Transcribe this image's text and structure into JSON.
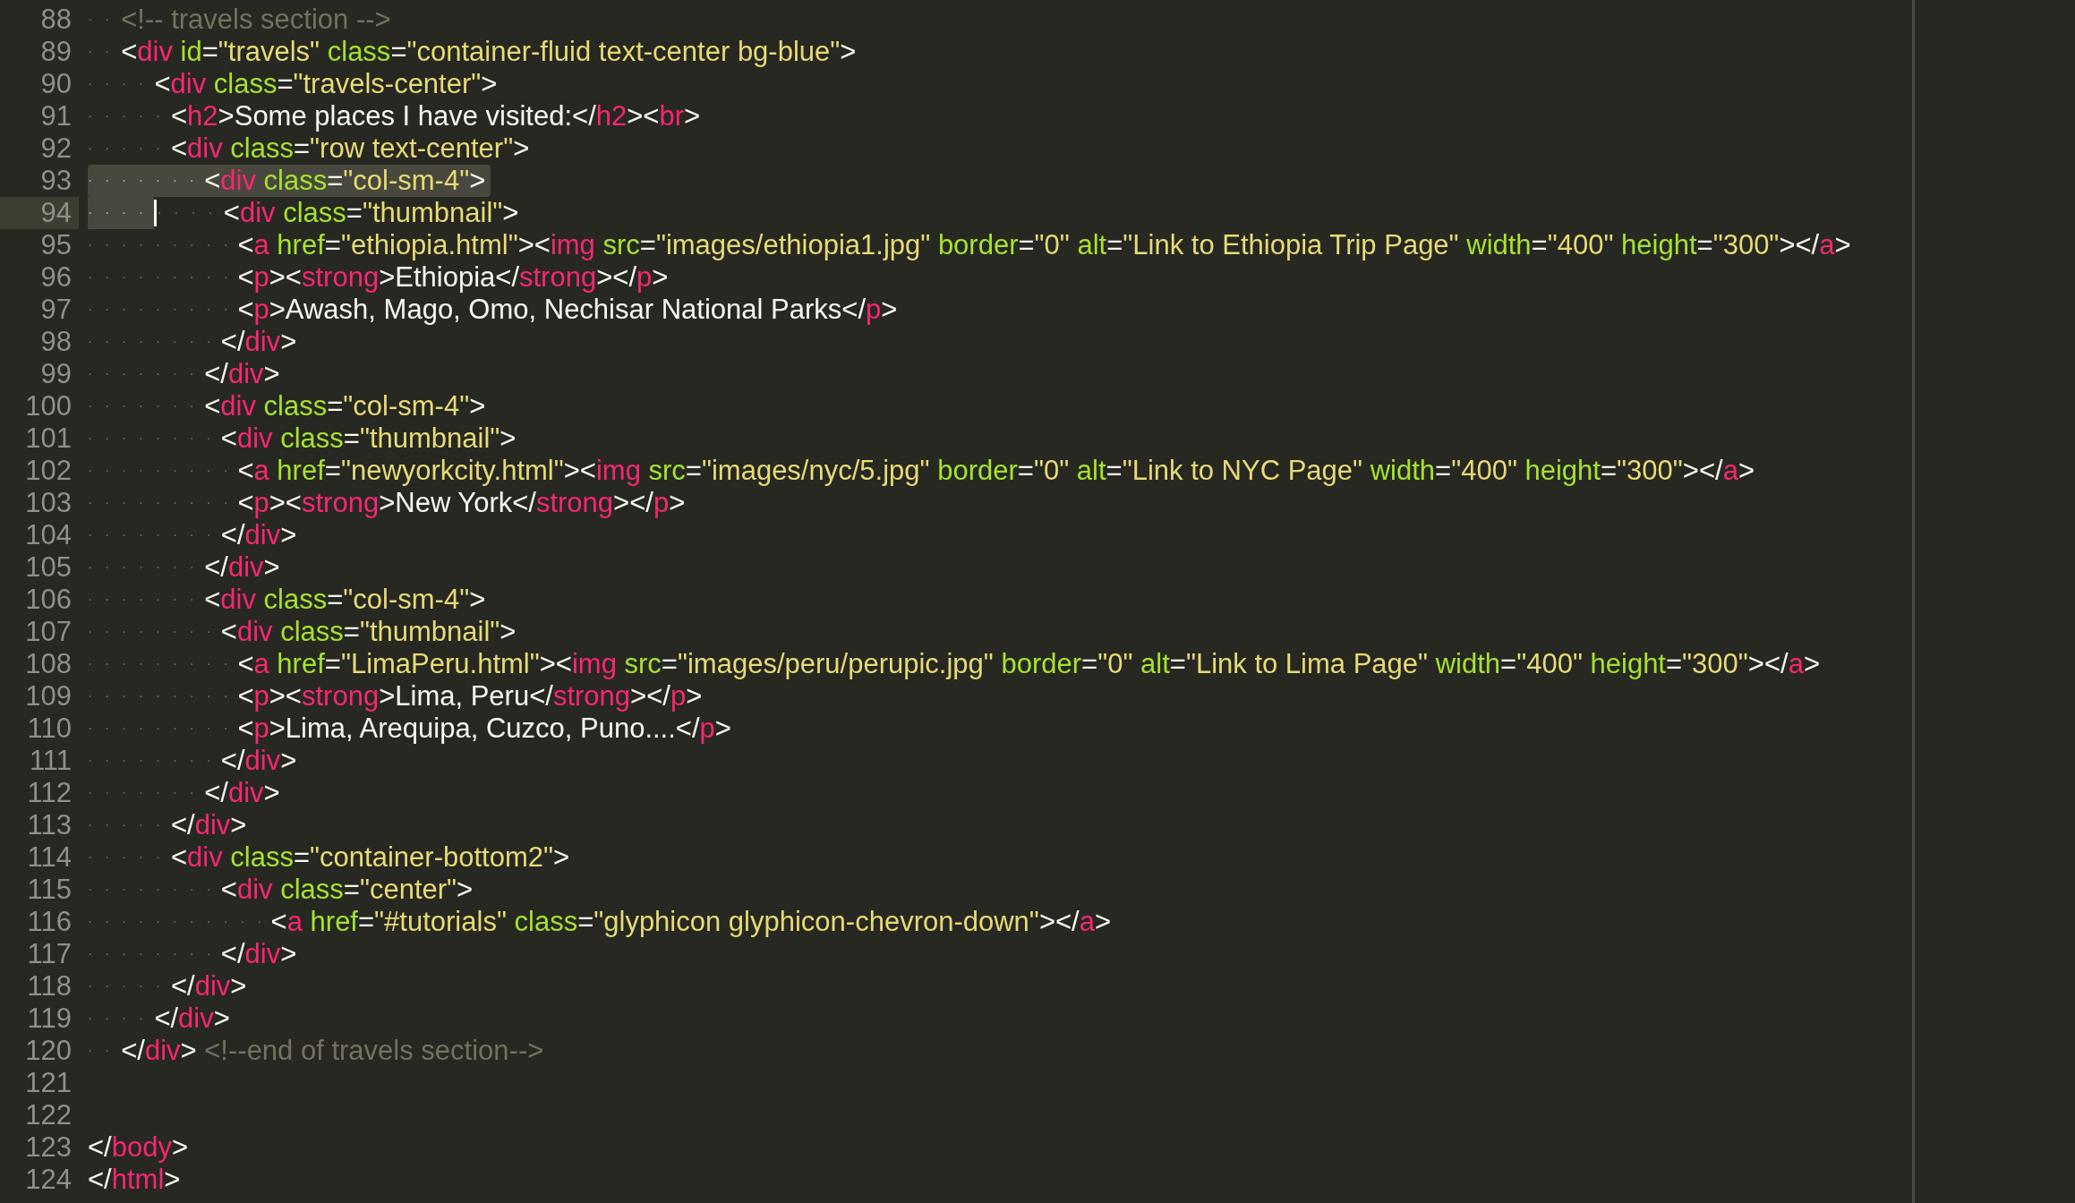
{
  "editor": {
    "lines": [
      {
        "number": "88",
        "tokens": [
          {
            "kind": "ws",
            "text": "··"
          },
          {
            "kind": "comment",
            "text": "<!-- travels section -->"
          }
        ]
      },
      {
        "number": "89",
        "tokens": [
          {
            "kind": "ws",
            "text": "··"
          },
          {
            "kind": "punct",
            "text": "<"
          },
          {
            "kind": "tag",
            "text": "div"
          },
          {
            "kind": "attr",
            "text": " id"
          },
          {
            "kind": "punct",
            "text": "="
          },
          {
            "kind": "string",
            "text": "\"travels\""
          },
          {
            "kind": "attr",
            "text": " class"
          },
          {
            "kind": "punct",
            "text": "="
          },
          {
            "kind": "string",
            "text": "\"container-fluid text-center bg-blue\""
          },
          {
            "kind": "punct",
            "text": ">"
          }
        ]
      },
      {
        "number": "90",
        "tokens": [
          {
            "kind": "ws",
            "text": "····"
          },
          {
            "kind": "punct",
            "text": "<"
          },
          {
            "kind": "tag",
            "text": "div"
          },
          {
            "kind": "attr",
            "text": " class"
          },
          {
            "kind": "punct",
            "text": "="
          },
          {
            "kind": "string",
            "text": "\"travels-center\""
          },
          {
            "kind": "punct",
            "text": ">"
          }
        ]
      },
      {
        "number": "91",
        "tokens": [
          {
            "kind": "ws",
            "text": "·····"
          },
          {
            "kind": "punct",
            "text": "<"
          },
          {
            "kind": "tag",
            "text": "h2"
          },
          {
            "kind": "punct",
            "text": ">"
          },
          {
            "kind": "text",
            "text": "Some places I have visited:"
          },
          {
            "kind": "punct",
            "text": "</"
          },
          {
            "kind": "tag",
            "text": "h2"
          },
          {
            "kind": "punct",
            "text": "><"
          },
          {
            "kind": "tag",
            "text": "br"
          },
          {
            "kind": "punct",
            "text": ">"
          }
        ]
      },
      {
        "number": "92",
        "tokens": [
          {
            "kind": "ws",
            "text": "·····"
          },
          {
            "kind": "punct",
            "text": "<"
          },
          {
            "kind": "tag",
            "text": "div"
          },
          {
            "kind": "attr",
            "text": " class"
          },
          {
            "kind": "punct",
            "text": "="
          },
          {
            "kind": "string",
            "text": "\"row text-center\""
          },
          {
            "kind": "punct",
            "text": ">"
          }
        ]
      },
      {
        "number": "93",
        "selected": true,
        "tokens": [
          {
            "kind": "ws",
            "text": "·······"
          },
          {
            "kind": "punct",
            "text": "<"
          },
          {
            "kind": "tag",
            "text": "div"
          },
          {
            "kind": "attr",
            "text": " class"
          },
          {
            "kind": "punct",
            "text": "="
          },
          {
            "kind": "string",
            "text": "\"col-sm-4\""
          },
          {
            "kind": "punct",
            "text": ">"
          }
        ]
      },
      {
        "number": "94",
        "current": true,
        "tokens": [
          {
            "kind": "ws",
            "text": "····",
            "selected": true
          },
          {
            "kind": "caret"
          },
          {
            "kind": "ws",
            "text": "····"
          },
          {
            "kind": "punct",
            "text": "<"
          },
          {
            "kind": "tag",
            "text": "div"
          },
          {
            "kind": "attr",
            "text": " class"
          },
          {
            "kind": "punct",
            "text": "="
          },
          {
            "kind": "string",
            "text": "\"thumbnail\""
          },
          {
            "kind": "punct",
            "text": ">"
          }
        ]
      },
      {
        "number": "95",
        "tokens": [
          {
            "kind": "ws",
            "text": "·········"
          },
          {
            "kind": "punct",
            "text": "<"
          },
          {
            "kind": "tag",
            "text": "a"
          },
          {
            "kind": "attr",
            "text": " href"
          },
          {
            "kind": "punct",
            "text": "="
          },
          {
            "kind": "string",
            "text": "\"ethiopia.html\""
          },
          {
            "kind": "punct",
            "text": "><"
          },
          {
            "kind": "tag",
            "text": "img"
          },
          {
            "kind": "attr",
            "text": " src"
          },
          {
            "kind": "punct",
            "text": "="
          },
          {
            "kind": "string",
            "text": "\"images/ethiopia1.jpg\""
          },
          {
            "kind": "attr",
            "text": " border"
          },
          {
            "kind": "punct",
            "text": "="
          },
          {
            "kind": "string",
            "text": "\"0\""
          },
          {
            "kind": "attr",
            "text": " alt"
          },
          {
            "kind": "punct",
            "text": "="
          },
          {
            "kind": "string",
            "text": "\"Link to Ethiopia Trip Page\""
          },
          {
            "kind": "attr",
            "text": " width"
          },
          {
            "kind": "punct",
            "text": "="
          },
          {
            "kind": "string",
            "text": "\"400\""
          },
          {
            "kind": "attr",
            "text": " height"
          },
          {
            "kind": "punct",
            "text": "="
          },
          {
            "kind": "string",
            "text": "\"300\""
          },
          {
            "kind": "punct",
            "text": "></"
          },
          {
            "kind": "tag",
            "text": "a"
          },
          {
            "kind": "punct",
            "text": ">"
          }
        ]
      },
      {
        "number": "96",
        "tokens": [
          {
            "kind": "ws",
            "text": "·········"
          },
          {
            "kind": "punct",
            "text": "<"
          },
          {
            "kind": "tag",
            "text": "p"
          },
          {
            "kind": "punct",
            "text": "><"
          },
          {
            "kind": "tag",
            "text": "strong"
          },
          {
            "kind": "punct",
            "text": ">"
          },
          {
            "kind": "text",
            "text": "Ethiopia"
          },
          {
            "kind": "punct",
            "text": "</"
          },
          {
            "kind": "tag",
            "text": "strong"
          },
          {
            "kind": "punct",
            "text": "></"
          },
          {
            "kind": "tag",
            "text": "p"
          },
          {
            "kind": "punct",
            "text": ">"
          }
        ]
      },
      {
        "number": "97",
        "tokens": [
          {
            "kind": "ws",
            "text": "·········"
          },
          {
            "kind": "punct",
            "text": "<"
          },
          {
            "kind": "tag",
            "text": "p"
          },
          {
            "kind": "punct",
            "text": ">"
          },
          {
            "kind": "text",
            "text": "Awash, Mago, Omo, Nechisar National Parks"
          },
          {
            "kind": "punct",
            "text": "</"
          },
          {
            "kind": "tag",
            "text": "p"
          },
          {
            "kind": "punct",
            "text": ">"
          }
        ]
      },
      {
        "number": "98",
        "tokens": [
          {
            "kind": "ws",
            "text": "········"
          },
          {
            "kind": "punct",
            "text": "</"
          },
          {
            "kind": "tag",
            "text": "div"
          },
          {
            "kind": "punct",
            "text": ">"
          }
        ]
      },
      {
        "number": "99",
        "tokens": [
          {
            "kind": "ws",
            "text": "·······"
          },
          {
            "kind": "punct",
            "text": "</"
          },
          {
            "kind": "tag",
            "text": "div"
          },
          {
            "kind": "punct",
            "text": ">"
          }
        ]
      },
      {
        "number": "100",
        "tokens": [
          {
            "kind": "ws",
            "text": "·······"
          },
          {
            "kind": "punct",
            "text": "<"
          },
          {
            "kind": "tag",
            "text": "div"
          },
          {
            "kind": "attr",
            "text": " class"
          },
          {
            "kind": "punct",
            "text": "="
          },
          {
            "kind": "string",
            "text": "\"col-sm-4\""
          },
          {
            "kind": "punct",
            "text": ">"
          }
        ]
      },
      {
        "number": "101",
        "tokens": [
          {
            "kind": "ws",
            "text": "········"
          },
          {
            "kind": "punct",
            "text": "<"
          },
          {
            "kind": "tag",
            "text": "div"
          },
          {
            "kind": "attr",
            "text": " class"
          },
          {
            "kind": "punct",
            "text": "="
          },
          {
            "kind": "string",
            "text": "\"thumbnail\""
          },
          {
            "kind": "punct",
            "text": ">"
          }
        ]
      },
      {
        "number": "102",
        "tokens": [
          {
            "kind": "ws",
            "text": "·········"
          },
          {
            "kind": "punct",
            "text": "<"
          },
          {
            "kind": "tag",
            "text": "a"
          },
          {
            "kind": "attr",
            "text": " href"
          },
          {
            "kind": "punct",
            "text": "="
          },
          {
            "kind": "string",
            "text": "\"newyorkcity.html\""
          },
          {
            "kind": "punct",
            "text": "><"
          },
          {
            "kind": "tag",
            "text": "img"
          },
          {
            "kind": "attr",
            "text": " src"
          },
          {
            "kind": "punct",
            "text": "="
          },
          {
            "kind": "string",
            "text": "\"images/nyc/5.jpg\""
          },
          {
            "kind": "attr",
            "text": " border"
          },
          {
            "kind": "punct",
            "text": "="
          },
          {
            "kind": "string",
            "text": "\"0\""
          },
          {
            "kind": "attr",
            "text": " alt"
          },
          {
            "kind": "punct",
            "text": "="
          },
          {
            "kind": "string",
            "text": "\"Link to NYC Page\""
          },
          {
            "kind": "attr",
            "text": " width"
          },
          {
            "kind": "punct",
            "text": "="
          },
          {
            "kind": "string",
            "text": "\"400\""
          },
          {
            "kind": "attr",
            "text": " height"
          },
          {
            "kind": "punct",
            "text": "="
          },
          {
            "kind": "string",
            "text": "\"300\""
          },
          {
            "kind": "punct",
            "text": "></"
          },
          {
            "kind": "tag",
            "text": "a"
          },
          {
            "kind": "punct",
            "text": ">"
          }
        ]
      },
      {
        "number": "103",
        "tokens": [
          {
            "kind": "ws",
            "text": "·········"
          },
          {
            "kind": "punct",
            "text": "<"
          },
          {
            "kind": "tag",
            "text": "p"
          },
          {
            "kind": "punct",
            "text": "><"
          },
          {
            "kind": "tag",
            "text": "strong"
          },
          {
            "kind": "punct",
            "text": ">"
          },
          {
            "kind": "text",
            "text": "New York"
          },
          {
            "kind": "punct",
            "text": "</"
          },
          {
            "kind": "tag",
            "text": "strong"
          },
          {
            "kind": "punct",
            "text": "></"
          },
          {
            "kind": "tag",
            "text": "p"
          },
          {
            "kind": "punct",
            "text": ">"
          }
        ]
      },
      {
        "number": "104",
        "tokens": [
          {
            "kind": "ws",
            "text": "········"
          },
          {
            "kind": "punct",
            "text": "</"
          },
          {
            "kind": "tag",
            "text": "div"
          },
          {
            "kind": "punct",
            "text": ">"
          }
        ]
      },
      {
        "number": "105",
        "tokens": [
          {
            "kind": "ws",
            "text": "·······"
          },
          {
            "kind": "punct",
            "text": "</"
          },
          {
            "kind": "tag",
            "text": "div"
          },
          {
            "kind": "punct",
            "text": ">"
          }
        ]
      },
      {
        "number": "106",
        "tokens": [
          {
            "kind": "ws",
            "text": "·······"
          },
          {
            "kind": "punct",
            "text": "<"
          },
          {
            "kind": "tag",
            "text": "div"
          },
          {
            "kind": "attr",
            "text": " class"
          },
          {
            "kind": "punct",
            "text": "="
          },
          {
            "kind": "string",
            "text": "\"col-sm-4\""
          },
          {
            "kind": "punct",
            "text": ">"
          }
        ]
      },
      {
        "number": "107",
        "tokens": [
          {
            "kind": "ws",
            "text": "········"
          },
          {
            "kind": "punct",
            "text": "<"
          },
          {
            "kind": "tag",
            "text": "div"
          },
          {
            "kind": "attr",
            "text": " class"
          },
          {
            "kind": "punct",
            "text": "="
          },
          {
            "kind": "string",
            "text": "\"thumbnail\""
          },
          {
            "kind": "punct",
            "text": ">"
          }
        ]
      },
      {
        "number": "108",
        "tokens": [
          {
            "kind": "ws",
            "text": "·········"
          },
          {
            "kind": "punct",
            "text": "<"
          },
          {
            "kind": "tag",
            "text": "a"
          },
          {
            "kind": "attr",
            "text": " href"
          },
          {
            "kind": "punct",
            "text": "="
          },
          {
            "kind": "string",
            "text": "\"LimaPeru.html\""
          },
          {
            "kind": "punct",
            "text": "><"
          },
          {
            "kind": "tag",
            "text": "img"
          },
          {
            "kind": "attr",
            "text": " src"
          },
          {
            "kind": "punct",
            "text": "="
          },
          {
            "kind": "string",
            "text": "\"images/peru/perupic.jpg\""
          },
          {
            "kind": "attr",
            "text": " border"
          },
          {
            "kind": "punct",
            "text": "="
          },
          {
            "kind": "string",
            "text": "\"0\""
          },
          {
            "kind": "attr",
            "text": " alt"
          },
          {
            "kind": "punct",
            "text": "="
          },
          {
            "kind": "string",
            "text": "\"Link to Lima Page\""
          },
          {
            "kind": "attr",
            "text": " width"
          },
          {
            "kind": "punct",
            "text": "="
          },
          {
            "kind": "string",
            "text": "\"400\""
          },
          {
            "kind": "attr",
            "text": " height"
          },
          {
            "kind": "punct",
            "text": "="
          },
          {
            "kind": "string",
            "text": "\"300\""
          },
          {
            "kind": "punct",
            "text": "></"
          },
          {
            "kind": "tag",
            "text": "a"
          },
          {
            "kind": "punct",
            "text": ">"
          }
        ]
      },
      {
        "number": "109",
        "tokens": [
          {
            "kind": "ws",
            "text": "·········"
          },
          {
            "kind": "punct",
            "text": "<"
          },
          {
            "kind": "tag",
            "text": "p"
          },
          {
            "kind": "punct",
            "text": "><"
          },
          {
            "kind": "tag",
            "text": "strong"
          },
          {
            "kind": "punct",
            "text": ">"
          },
          {
            "kind": "text",
            "text": "Lima, Peru"
          },
          {
            "kind": "punct",
            "text": "</"
          },
          {
            "kind": "tag",
            "text": "strong"
          },
          {
            "kind": "punct",
            "text": "></"
          },
          {
            "kind": "tag",
            "text": "p"
          },
          {
            "kind": "punct",
            "text": ">"
          }
        ]
      },
      {
        "number": "110",
        "tokens": [
          {
            "kind": "ws",
            "text": "·········"
          },
          {
            "kind": "punct",
            "text": "<"
          },
          {
            "kind": "tag",
            "text": "p"
          },
          {
            "kind": "punct",
            "text": ">"
          },
          {
            "kind": "text",
            "text": "Lima, Arequipa, Cuzco, Puno...."
          },
          {
            "kind": "punct",
            "text": "</"
          },
          {
            "kind": "tag",
            "text": "p"
          },
          {
            "kind": "punct",
            "text": ">"
          }
        ]
      },
      {
        "number": "111",
        "tokens": [
          {
            "kind": "ws",
            "text": "········"
          },
          {
            "kind": "punct",
            "text": "</"
          },
          {
            "kind": "tag",
            "text": "div"
          },
          {
            "kind": "punct",
            "text": ">"
          }
        ]
      },
      {
        "number": "112",
        "tokens": [
          {
            "kind": "ws",
            "text": "·······"
          },
          {
            "kind": "punct",
            "text": "</"
          },
          {
            "kind": "tag",
            "text": "div"
          },
          {
            "kind": "punct",
            "text": ">"
          }
        ]
      },
      {
        "number": "113",
        "tokens": [
          {
            "kind": "ws",
            "text": "·····"
          },
          {
            "kind": "punct",
            "text": "</"
          },
          {
            "kind": "tag",
            "text": "div"
          },
          {
            "kind": "punct",
            "text": ">"
          }
        ]
      },
      {
        "number": "114",
        "tokens": [
          {
            "kind": "ws",
            "text": "·····"
          },
          {
            "kind": "punct",
            "text": "<"
          },
          {
            "kind": "tag",
            "text": "div"
          },
          {
            "kind": "attr",
            "text": " class"
          },
          {
            "kind": "punct",
            "text": "="
          },
          {
            "kind": "string",
            "text": "\"container-bottom2\""
          },
          {
            "kind": "punct",
            "text": ">"
          }
        ]
      },
      {
        "number": "115",
        "tokens": [
          {
            "kind": "ws",
            "text": "········"
          },
          {
            "kind": "punct",
            "text": "<"
          },
          {
            "kind": "tag",
            "text": "div"
          },
          {
            "kind": "attr",
            "text": " class"
          },
          {
            "kind": "punct",
            "text": "="
          },
          {
            "kind": "string",
            "text": "\"center\""
          },
          {
            "kind": "punct",
            "text": ">"
          }
        ]
      },
      {
        "number": "116",
        "tokens": [
          {
            "kind": "ws",
            "text": "···········"
          },
          {
            "kind": "punct",
            "text": "<"
          },
          {
            "kind": "tag",
            "text": "a"
          },
          {
            "kind": "attr",
            "text": " href"
          },
          {
            "kind": "punct",
            "text": "="
          },
          {
            "kind": "string",
            "text": "\"#tutorials\""
          },
          {
            "kind": "attr",
            "text": " class"
          },
          {
            "kind": "punct",
            "text": "="
          },
          {
            "kind": "string",
            "text": "\"glyphicon glyphicon-chevron-down\""
          },
          {
            "kind": "punct",
            "text": "></"
          },
          {
            "kind": "tag",
            "text": "a"
          },
          {
            "kind": "punct",
            "text": ">"
          }
        ]
      },
      {
        "number": "117",
        "tokens": [
          {
            "kind": "ws",
            "text": "········"
          },
          {
            "kind": "punct",
            "text": "</"
          },
          {
            "kind": "tag",
            "text": "div"
          },
          {
            "kind": "punct",
            "text": ">"
          }
        ]
      },
      {
        "number": "118",
        "tokens": [
          {
            "kind": "ws",
            "text": "·····"
          },
          {
            "kind": "punct",
            "text": "</"
          },
          {
            "kind": "tag",
            "text": "div"
          },
          {
            "kind": "punct",
            "text": ">"
          }
        ]
      },
      {
        "number": "119",
        "tokens": [
          {
            "kind": "ws",
            "text": "····"
          },
          {
            "kind": "punct",
            "text": "</"
          },
          {
            "kind": "tag",
            "text": "div"
          },
          {
            "kind": "punct",
            "text": ">"
          }
        ]
      },
      {
        "number": "120",
        "tokens": [
          {
            "kind": "ws",
            "text": "··"
          },
          {
            "kind": "punct",
            "text": "</"
          },
          {
            "kind": "tag",
            "text": "div"
          },
          {
            "kind": "punct",
            "text": ">"
          },
          {
            "kind": "comment",
            "text": " <!--end of travels section-->"
          }
        ]
      },
      {
        "number": "121"
      },
      {
        "number": "122"
      },
      {
        "number": "123",
        "tokens": [
          {
            "kind": "punct",
            "text": "</"
          },
          {
            "kind": "tag",
            "text": "body"
          },
          {
            "kind": "punct",
            "text": ">"
          }
        ]
      },
      {
        "number": "124",
        "tokens": [
          {
            "kind": "punct",
            "text": "</"
          },
          {
            "kind": "tag",
            "text": "html"
          },
          {
            "kind": "punct",
            "text": ">"
          }
        ]
      }
    ]
  }
}
